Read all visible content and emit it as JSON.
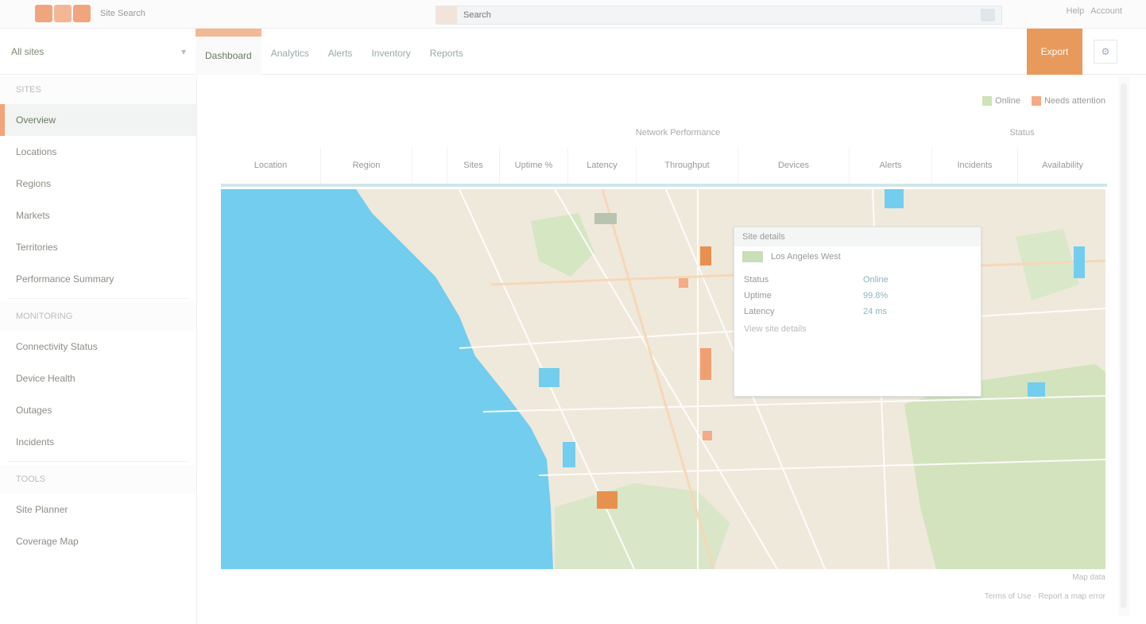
{
  "app": {
    "brand": "Site Search",
    "search_placeholder": "Search",
    "user_links": [
      "Help",
      "Account"
    ]
  },
  "secondbar": {
    "scope_label": "All sites",
    "tabs": [
      "Dashboard",
      "Analytics",
      "Alerts",
      "Inventory",
      "Reports"
    ],
    "action_label": "Export"
  },
  "sidebar": {
    "section_1": "SITES",
    "items_1": [
      "Overview",
      "Locations",
      "Regions",
      "Markets",
      "Territories",
      "Performance Summary"
    ],
    "section_2": "MONITORING",
    "items_2": [
      "Connectivity Status",
      "Device Health",
      "Outages",
      "Incidents"
    ],
    "section_3": "TOOLS",
    "items_3": [
      "Site Planner",
      "Coverage Map"
    ]
  },
  "legend": {
    "online": "Online",
    "offline": "Needs attention"
  },
  "table": {
    "group_1": "Network Performance",
    "group_2": "Status",
    "headers": [
      "Location",
      "Region",
      "Sites",
      "Uptime %",
      "Latency",
      "Throughput",
      "Devices",
      "Alerts",
      "Incidents",
      "Availability"
    ]
  },
  "popup": {
    "title": "Site details",
    "site_name": "Los Angeles West",
    "rows": [
      {
        "k": "Status",
        "v": "Online"
      },
      {
        "k": "Uptime",
        "v": "99.8%"
      },
      {
        "k": "Latency",
        "v": "24 ms"
      }
    ],
    "foot": "View site details"
  },
  "map": {
    "water_color": "#73cdee",
    "land_color": "#efe9dc",
    "park_color": "#cfe2b9",
    "markers": 6
  },
  "footer": {
    "attribution": "Map data",
    "copyright": "Terms of Use · Report a map error"
  }
}
